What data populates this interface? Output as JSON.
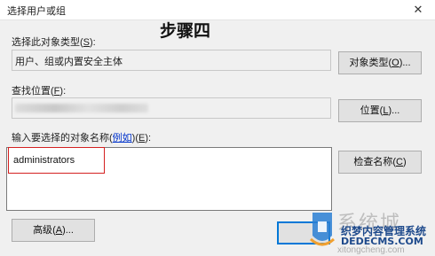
{
  "window": {
    "title": "选择用户或组",
    "close_glyph": "✕"
  },
  "annotation": {
    "step": "步骤四"
  },
  "object_type": {
    "label_text": "选择此对象类型",
    "label_key": "S",
    "value": "用户、组或内置安全主体",
    "button_text": "对象类型",
    "button_key": "O",
    "button_suffix": "..."
  },
  "location": {
    "label_text": "查找位置",
    "label_key": "F",
    "button_text": "位置",
    "button_key": "L",
    "button_suffix": "..."
  },
  "names": {
    "label_text": "输入要选择的对象名称",
    "label_link": "例如",
    "label_key": "E",
    "value": "administrators",
    "check_button_text": "检查名称",
    "check_button_key": "C"
  },
  "footer": {
    "advanced_text": "高级",
    "advanced_key": "A",
    "advanced_suffix": "..."
  },
  "watermark": {
    "big_text": "系统城",
    "cms_line1": "织梦内容管理系统",
    "cms_line2": "DEDECMS.COM",
    "url": "xitongcheng.com"
  },
  "colors": {
    "highlight": "#d42020",
    "ok_focus": "#0078d7",
    "link": "#0033cc",
    "watermark_cms": "#1e4a8c"
  }
}
